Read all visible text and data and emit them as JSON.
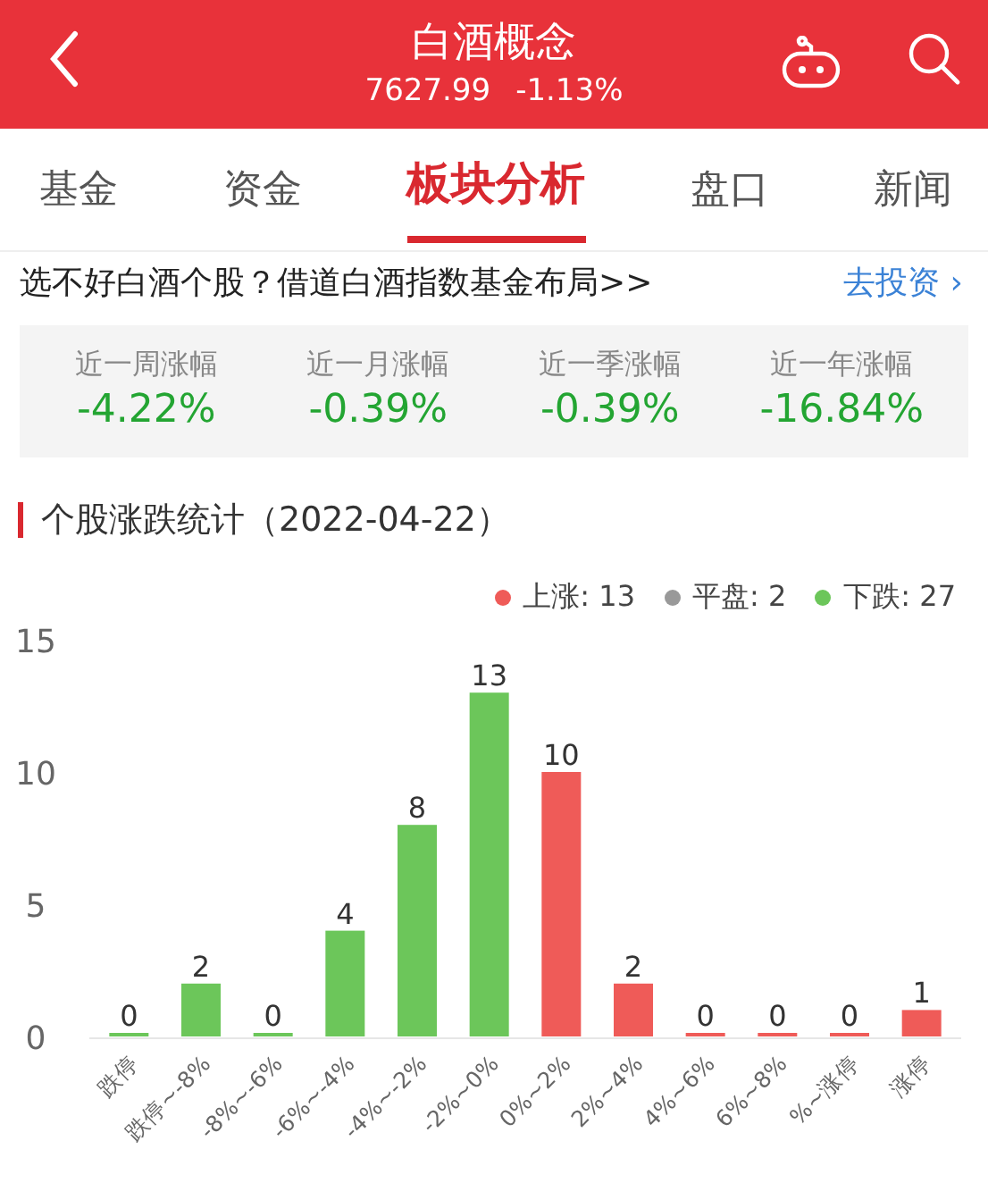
{
  "header": {
    "title": "白酒概念",
    "price": "7627.99",
    "change": "-1.13%"
  },
  "tabs": [
    {
      "label": "基金",
      "selected": false
    },
    {
      "label": "资金",
      "selected": false
    },
    {
      "label": "板块分析",
      "selected": true
    },
    {
      "label": "盘口",
      "selected": false
    },
    {
      "label": "新闻",
      "selected": false
    }
  ],
  "promo": {
    "text": "选不好白酒个股？借道白酒指数基金布局>>",
    "link": "去投资",
    "link_icon": "›"
  },
  "stats": [
    {
      "label": "近一周涨幅",
      "value": "-4.22%"
    },
    {
      "label": "近一月涨幅",
      "value": "-0.39%"
    },
    {
      "label": "近一季涨幅",
      "value": "-0.39%"
    },
    {
      "label": "近一年涨幅",
      "value": "-16.84%"
    }
  ],
  "section": {
    "title": "个股涨跌统计（2022-04-22）"
  },
  "legend": [
    {
      "label": "上涨: 13",
      "color": "#ef5b58"
    },
    {
      "label": "平盘: 2",
      "color": "#999999"
    },
    {
      "label": "下跌: 27",
      "color": "#6cc65a"
    }
  ],
  "chart_data": {
    "type": "bar",
    "categories": [
      "跌停",
      "跌停~-8%",
      "-8%~-6%",
      "-6%~-4%",
      "-4%~-2%",
      "-2%~0%",
      "0%~2%",
      "2%~4%",
      "4%~6%",
      "6%~8%",
      "%~涨停",
      "涨停"
    ],
    "series": [
      {
        "color": "#6cc65a",
        "values": [
          0,
          2,
          0,
          4,
          8,
          13,
          null,
          null,
          null,
          null,
          null,
          null
        ]
      },
      {
        "color": "#ef5b58",
        "values": [
          null,
          null,
          null,
          null,
          null,
          null,
          10,
          2,
          0,
          0,
          0,
          1
        ]
      }
    ],
    "ylim": [
      0,
      15
    ],
    "yticks": [
      0,
      5,
      10,
      15
    ],
    "data_labels": true
  }
}
